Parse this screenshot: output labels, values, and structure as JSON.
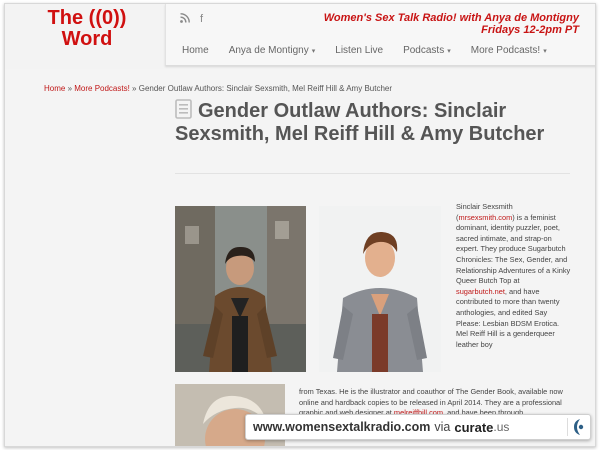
{
  "header": {
    "logo_line1": "The ((0))",
    "logo_line2": "Word",
    "tagline_line1": "Women's Sex Talk Radio! with Anya de Montigny",
    "tagline_line2": "Fridays 12-2pm PT",
    "social_icons": [
      "rss-icon",
      "facebook-icon"
    ],
    "facebook_glyph": "f"
  },
  "nav": {
    "items": [
      {
        "label": "Home",
        "has_caret": false
      },
      {
        "label": "Anya de Montigny",
        "has_caret": true
      },
      {
        "label": "Listen Live",
        "has_caret": false
      },
      {
        "label": "Podcasts",
        "has_caret": true
      },
      {
        "label": "More Podcasts!",
        "has_caret": true
      }
    ],
    "caret_glyph": "▾"
  },
  "breadcrumb": {
    "home": "Home",
    "sep1": " » ",
    "more": "More Podcasts!",
    "sep2": " » ",
    "current": "Gender Outlaw Authors: Sinclair Sexsmith, Mel Reiff Hill & Amy Butcher"
  },
  "article": {
    "title": "Gender Outlaw Authors: Sinclair Sexsmith, Mel Reiff Hill & Amy Butcher",
    "p1_a": "Sinclair Sexsmith (",
    "p1_link": "mrsexsmith.com",
    "p1_b": ") is a feminist dominant, identity puzzler, poet, sacred intimate, and strap-on expert. They produce Sugarbutch Chronicles: The Sex, Gender, and Relationship Adventures of a Kinky Queer Butch Top at ",
    "p1_link2": "sugarbutch.net",
    "p1_c": ", and have contributed to more than twenty anthologies, and edited Say Please: Lesbian BDSM Erotica.",
    "p2_a": "Mel Reiff Hill is a genderqueer leather boy",
    "p2_b": "from Texas. He is the illustrator and coauthor of The Gender Book, available now online and hardback copies to be released in April 2014. They are a professional graphic and web designer at ",
    "p2_link": "melreiffhill.com",
    "p2_c": ", and have been through transformations. She has been many things, including a bike tour"
  },
  "watermark": {
    "url": "www.womensextalkradio.com",
    "via": "via",
    "brand": "curate",
    "tld": ".us"
  }
}
